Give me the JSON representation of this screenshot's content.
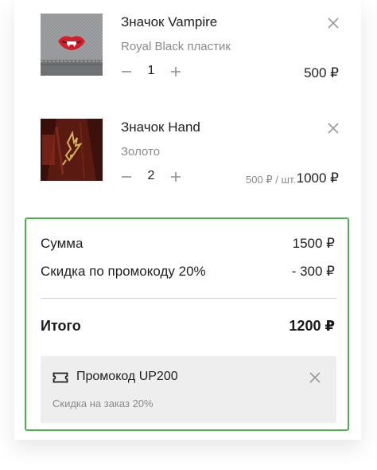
{
  "cart": {
    "items": [
      {
        "title": "Значок Vampire",
        "variant": "Royal Black пластик",
        "quantity": "1",
        "unit_price": "",
        "price": "500 ₽"
      },
      {
        "title": "Значок Hand",
        "variant": "Золото",
        "quantity": "2",
        "unit_price": "500 ₽ / шт.",
        "price": "1000 ₽"
      }
    ]
  },
  "summary": {
    "subtotal_label": "Сумма",
    "subtotal_value": "1500 ₽",
    "discount_label": "Скидка по промокоду 20%",
    "discount_value": "- 300 ₽",
    "total_label": "Итого",
    "total_value": "1200 ₽",
    "promo": {
      "code_text": "Промокод UP200",
      "note": "Скидка на заказ 20%",
      "icon": "ticket-icon"
    }
  },
  "colors": {
    "summary_border": "#4caf50",
    "promo_background": "#eeeeee",
    "muted_text": "#8a8a8a"
  }
}
